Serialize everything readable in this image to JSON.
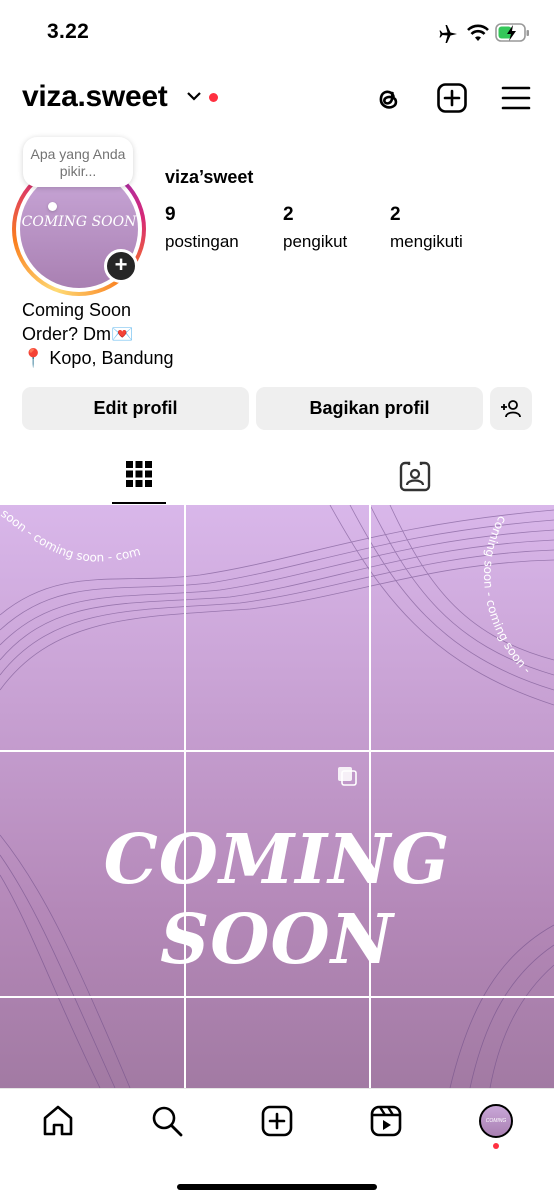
{
  "status_bar": {
    "time": "3.22"
  },
  "header": {
    "username": "viza.sweet"
  },
  "note": {
    "text": "Apa yang Anda pikir..."
  },
  "avatar": {
    "text": "COMING SOON"
  },
  "profile": {
    "display_name": "viza’sweet",
    "stats": [
      {
        "value": "9",
        "label": "postingan"
      },
      {
        "value": "2",
        "label": "pengikut"
      },
      {
        "value": "2",
        "label": "mengikuti"
      }
    ],
    "bio": [
      "Coming Soon",
      "Order? Dm💌",
      "📍 Kopo, Bandung"
    ]
  },
  "actions": {
    "edit": "Edit profil",
    "share": "Bagikan profil"
  },
  "grid": {
    "headline": "COMING SOON",
    "curve_text_left": "soon - coming soon - coming soon",
    "curve_text_right": "coming soon - coming soon -"
  },
  "colors": {
    "accent": "#ff3040",
    "button_bg": "#efefef",
    "grid_top": "#d9b7ea",
    "grid_bottom": "#a27aa3"
  }
}
